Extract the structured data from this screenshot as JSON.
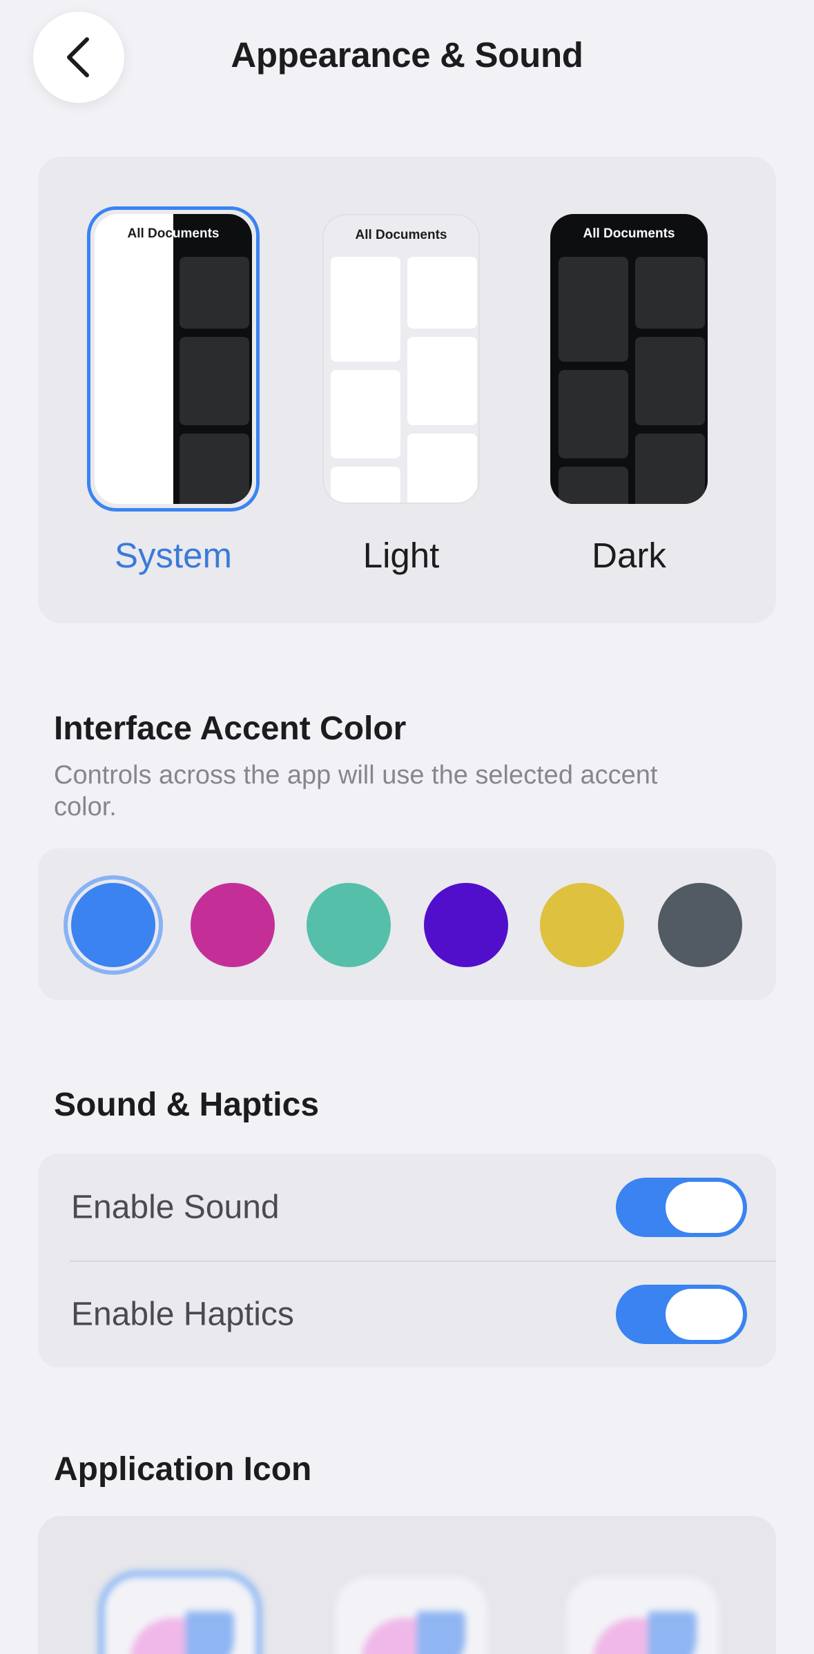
{
  "header": {
    "back_icon": "chevron-left-icon",
    "title": "Appearance & Sound"
  },
  "themes": {
    "preview_title": "All Documents",
    "options": [
      {
        "label": "System",
        "selected": true
      },
      {
        "label": "Light",
        "selected": false
      },
      {
        "label": "Dark",
        "selected": false
      }
    ]
  },
  "accent": {
    "heading": "Interface Accent Color",
    "description": "Controls across the app will use the selected accent color.",
    "swatches": [
      {
        "name": "blue",
        "color": "#3a83f1",
        "selected": true
      },
      {
        "name": "magenta",
        "color": "#c42f97",
        "selected": false
      },
      {
        "name": "teal",
        "color": "#56bfa9",
        "selected": false
      },
      {
        "name": "purple",
        "color": "#520fcb",
        "selected": false
      },
      {
        "name": "yellow",
        "color": "#ddc13f",
        "selected": false
      },
      {
        "name": "gray",
        "color": "#525b64",
        "selected": false
      }
    ]
  },
  "sound": {
    "heading": "Sound & Haptics",
    "rows": [
      {
        "label": "Enable Sound",
        "on": true
      },
      {
        "label": "Enable Haptics",
        "on": true
      }
    ]
  },
  "app_icon": {
    "heading": "Application Icon"
  },
  "colors": {
    "accent": "#3a83f1",
    "background": "#f1f1f6",
    "card": "#e9e9ee"
  }
}
